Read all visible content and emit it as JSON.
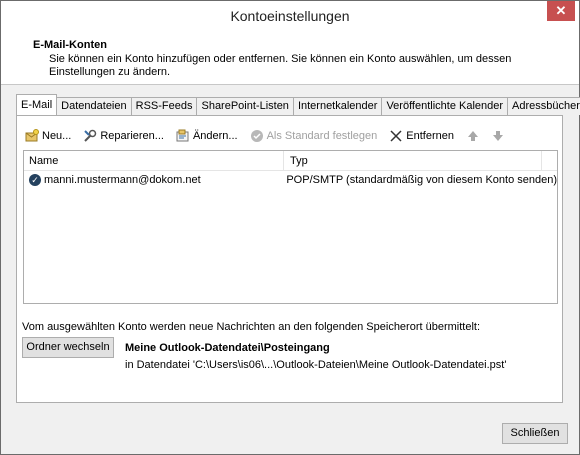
{
  "window": {
    "title": "Kontoeinstellungen",
    "close_glyph": "✕"
  },
  "header": {
    "title": "E-Mail-Konten",
    "description": "Sie können ein Konto hinzufügen oder entfernen. Sie können ein Konto auswählen, um dessen Einstellungen zu ändern."
  },
  "tabs": [
    "E-Mail",
    "Datendateien",
    "RSS-Feeds",
    "SharePoint-Listen",
    "Internetkalender",
    "Veröffentlichte Kalender",
    "Adressbücher"
  ],
  "toolbar": {
    "new": "Neu...",
    "repair": "Reparieren...",
    "change": "Ändern...",
    "set_default": "Als Standard festlegen",
    "remove": "Entfernen",
    "move_up_icon": "arrow-up-icon",
    "move_down_icon": "arrow-down-icon"
  },
  "list": {
    "columns": {
      "name": "Name",
      "type": "Typ"
    },
    "rows": [
      {
        "name": "manni.mustermann@dokom.net",
        "type": "POP/SMTP (standardmäßig von diesem Konto senden)"
      }
    ]
  },
  "store": {
    "info": "Vom ausgewählten Konto werden neue Nachrichten an den folgenden Speicherort übermittelt:",
    "change_folder": "Ordner wechseln",
    "name": "Meine Outlook-Datendatei\\Posteingang",
    "path": "in Datendatei 'C:\\Users\\is06\\...\\Outlook-Dateien\\Meine Outlook-Datendatei.pst'"
  },
  "footer": {
    "close": "Schließen"
  }
}
